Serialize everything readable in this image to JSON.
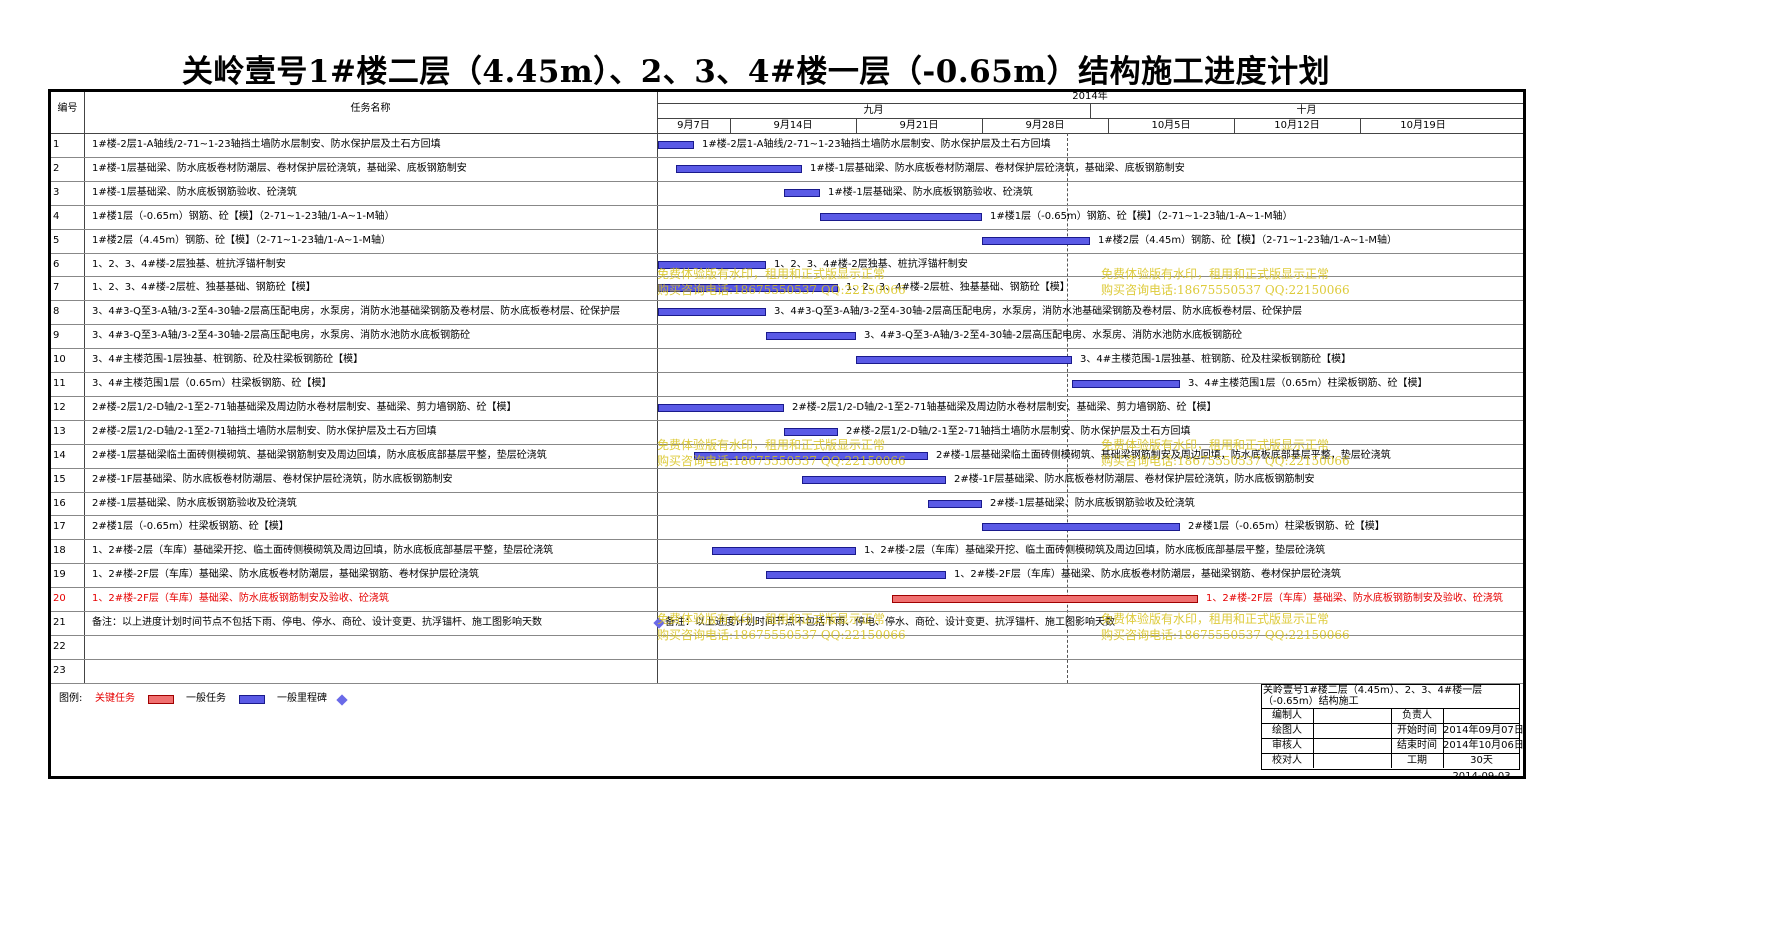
{
  "title": "关岭壹号1#楼二层（4.45m）、2、3、4#楼一层（-0.65m）结构施工进度计划",
  "header": {
    "col_id": "编号",
    "col_name": "任务名称",
    "year": "2014年",
    "month_sep": "九月",
    "month_oct": "十月",
    "weeks": [
      "9月7日",
      "9月14日",
      "9月21日",
      "9月28日",
      "10月5日",
      "10月12日",
      "10月19日"
    ]
  },
  "tasks": [
    {
      "id": "1",
      "name": "1#楼-2层1-A轴线/2-71~1-23轴挡土墙防水层制安、防水保护层及土石方回填",
      "critical": false,
      "start": "2014-09-07",
      "end": "2014-09-09",
      "label": "1#楼-2层1-A轴线/2-71~1-23轴挡土墙防水层制安、防水保护层及土石方回填"
    },
    {
      "id": "2",
      "name": "1#楼-1层基础梁、防水底板卷材防潮层、卷材保护层砼浇筑，基础梁、底板钢筋制安",
      "critical": false,
      "start": "2014-09-08",
      "end": "2014-09-15",
      "label": "1#楼-1层基础梁、防水底板卷材防潮层、卷材保护层砼浇筑，基础梁、底板钢筋制安"
    },
    {
      "id": "3",
      "name": "1#楼-1层基础梁、防水底板钢筋验收、砼浇筑",
      "critical": false,
      "start": "2014-09-14",
      "end": "2014-09-16",
      "label": "1#楼-1层基础梁、防水底板钢筋验收、砼浇筑"
    },
    {
      "id": "4",
      "name": "1#楼1层（-0.65m）钢筋、砼【模】（2-71~1-23轴/1-A~1-M轴）",
      "critical": false,
      "start": "2014-09-16",
      "end": "2014-09-25",
      "label": "1#楼1层（-0.65m）钢筋、砼【模】（2-71~1-23轴/1-A~1-M轴）"
    },
    {
      "id": "5",
      "name": "1#楼2层（4.45m）钢筋、砼【模】（2-71~1-23轴/1-A~1-M轴）",
      "critical": false,
      "start": "2014-09-25",
      "end": "2014-10-01",
      "label": "1#楼2层（4.45m）钢筋、砼【模】（2-71~1-23轴/1-A~1-M轴）"
    },
    {
      "id": "6",
      "name": "1、2、3、4#楼-2层独基、桩抗浮锚杆制安",
      "critical": false,
      "start": "2014-09-07",
      "end": "2014-09-13",
      "label": "1、2、3、4#楼-2层独基、桩抗浮锚杆制安"
    },
    {
      "id": "7",
      "name": "1、2、3、4#楼-2层桩、独基基础、钢筋砼【模】",
      "critical": false,
      "start": "2014-09-07",
      "end": "2014-09-17",
      "label": "1、2、3、4#楼-2层桩、独基基础、钢筋砼【模】"
    },
    {
      "id": "8",
      "name": "3、4#3-Q至3-A轴/3-2至4-30轴-2层高压配电房，水泵房，消防水池基础梁钢筋及卷材层、防水底板卷材层、砼保护层",
      "critical": false,
      "start": "2014-09-07",
      "end": "2014-09-13",
      "label": "3、4#3-Q至3-A轴/3-2至4-30轴-2层高压配电房，水泵房，消防水池基础梁钢筋及卷材层、防水底板卷材层、砼保护层"
    },
    {
      "id": "9",
      "name": "3、4#3-Q至3-A轴/3-2至4-30轴-2层高压配电房，水泵房、消防水池防水底板钢筋砼",
      "critical": false,
      "start": "2014-09-13",
      "end": "2014-09-18",
      "label": "3、4#3-Q至3-A轴/3-2至4-30轴-2层高压配电房、水泵房、消防水池防水底板钢筋砼"
    },
    {
      "id": "10",
      "name": "3、4#主楼范围-1层独基、桩钢筋、砼及柱梁板钢筋砼【模】",
      "critical": false,
      "start": "2014-09-18",
      "end": "2014-09-30",
      "label": "3、4#主楼范围-1层独基、桩钢筋、砼及柱梁板钢筋砼【模】"
    },
    {
      "id": "11",
      "name": "3、4#主楼范围1层（0.65m）柱梁板钢筋、砼【模】",
      "critical": false,
      "start": "2014-09-30",
      "end": "2014-10-06",
      "label": "3、4#主楼范围1层（0.65m）柱梁板钢筋、砼【模】"
    },
    {
      "id": "12",
      "name": "2#楼-2层1/2-D轴/2-1至2-71轴基础梁及周边防水卷材层制安、基础梁、剪力墙钢筋、砼【模】",
      "critical": false,
      "start": "2014-09-07",
      "end": "2014-09-14",
      "label": "2#楼-2层1/2-D轴/2-1至2-71轴基础梁及周边防水卷材层制安、基础梁、剪力墙钢筋、砼【模】"
    },
    {
      "id": "13",
      "name": "2#楼-2层1/2-D轴/2-1至2-71轴挡土墙防水层制安、防水保护层及土石方回填",
      "critical": false,
      "start": "2014-09-14",
      "end": "2014-09-17",
      "label": "2#楼-2层1/2-D轴/2-1至2-71轴挡土墙防水层制安、防水保护层及土石方回填"
    },
    {
      "id": "14",
      "name": "2#楼-1层基础梁临土面砖侧模砌筑、基础梁钢筋制安及周边回填，防水底板底部基层平整，垫层砼浇筑",
      "critical": false,
      "start": "2014-09-09",
      "end": "2014-09-22",
      "label": "2#楼-1层基础梁临土面砖侧模砌筑、基础梁钢筋制安及周边回填，防水底板底部基层平整，垫层砼浇筑"
    },
    {
      "id": "15",
      "name": "2#楼-1F层基础梁、防水底板卷材防潮层、卷材保护层砼浇筑，防水底板钢筋制安",
      "critical": false,
      "start": "2014-09-15",
      "end": "2014-09-23",
      "label": "2#楼-1F层基础梁、防水底板卷材防潮层、卷材保护层砼浇筑，防水底板钢筋制安"
    },
    {
      "id": "16",
      "name": "2#楼-1层基础梁、防水底板钢筋验收及砼浇筑",
      "critical": false,
      "start": "2014-09-22",
      "end": "2014-09-25",
      "label": "2#楼-1层基础梁、防水底板钢筋验收及砼浇筑"
    },
    {
      "id": "17",
      "name": "2#楼1层（-0.65m）柱梁板钢筋、砼【模】",
      "critical": false,
      "start": "2014-09-25",
      "end": "2014-10-06",
      "label": "2#楼1层（-0.65m）柱梁板钢筋、砼【模】"
    },
    {
      "id": "18",
      "name": "1、2#楼-2层（车库）基础梁开挖、临土面砖侧模砌筑及周边回填，防水底板底部基层平整，垫层砼浇筑",
      "critical": false,
      "start": "2014-09-10",
      "end": "2014-09-18",
      "label": "1、2#楼-2层（车库）基础梁开挖、临土面砖侧模砌筑及周边回填，防水底板底部基层平整，垫层砼浇筑"
    },
    {
      "id": "19",
      "name": "1、2#楼-2F层（车库）基础梁、防水底板卷材防潮层，基础梁钢筋、卷材保护层砼浇筑",
      "critical": false,
      "start": "2014-09-13",
      "end": "2014-09-23",
      "label": "1、2#楼-2F层（车库）基础梁、防水底板卷材防潮层，基础梁钢筋、卷材保护层砼浇筑"
    },
    {
      "id": "20",
      "name": "1、2#楼-2F层（车库）基础梁、防水底板钢筋制安及验收、砼浇筑",
      "critical": true,
      "start": "2014-09-20",
      "end": "2014-10-07",
      "label": "1、2#楼-2F层（车库）基础梁、防水底板钢筋制安及验收、砼浇筑"
    },
    {
      "id": "21",
      "name": "备注：以上进度计划时间节点不包括下雨、停电、停水、商砼、设计变更、抗浮锚杆、施工图影响天数",
      "critical": false,
      "milestone": true,
      "start": "2014-09-07",
      "label": "备注：以上进度计划时间节点不包括下雨、停电、停水、商砼、设计变更、抗浮锚杆、施工图影响天数"
    },
    {
      "id": "22",
      "name": ""
    },
    {
      "id": "23",
      "name": ""
    }
  ],
  "legend": {
    "label": "图例:",
    "critical": "关键任务",
    "normal": "一般任务",
    "milestone": "一般里程碑"
  },
  "info_box": {
    "title": "关岭壹号1#楼二层（4.45m）、2、3、4#楼一层（-0.65m）结构施工",
    "editor_label": "编制人",
    "owner_label": "负责人",
    "drawer_label": "绘图人",
    "start_label": "开始时间",
    "start_value": "2014年09月07日",
    "reviewer_label": "审核人",
    "end_label": "结束时间",
    "end_value": "2014年10月06日",
    "checker_label": "校对人",
    "duration_label": "工期",
    "duration_value": "30天",
    "print_date": "2014-09-03"
  },
  "watermark": {
    "line1": "免费体验版有水印，租用和正式版显示正常",
    "line2": "购买咨询电话:18675550537 QQ:22150066"
  },
  "colors": {
    "normal_bar": "#5a5ae6",
    "critical_bar": "#f07070",
    "critical_text": "#e60000",
    "milestone": "#6a6ae8",
    "watermark": "#d8c21a"
  }
}
